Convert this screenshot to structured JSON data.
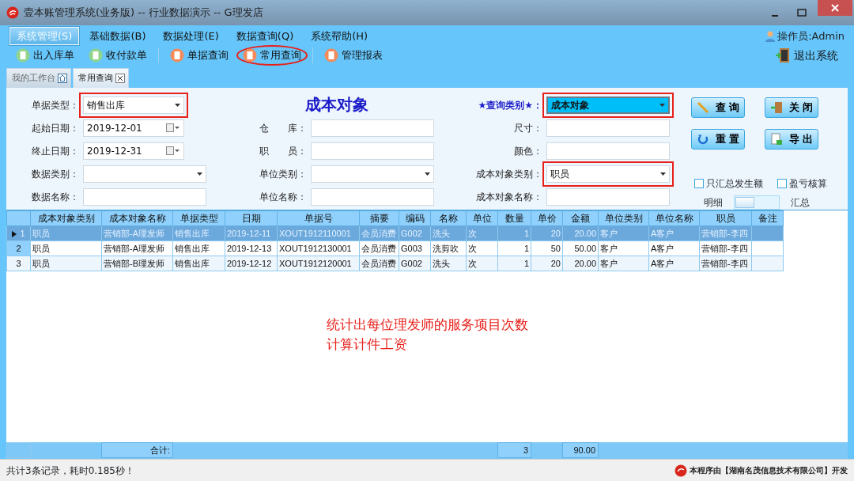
{
  "window": {
    "title": "壹本账管理系统(业务版) -- 行业数据演示 -- G理发店"
  },
  "menu": [
    {
      "label": "系统管理(S)",
      "selected": true
    },
    {
      "label": "基础数据(B)",
      "selected": false
    },
    {
      "label": "数据处理(E)",
      "selected": false
    },
    {
      "label": "数据查询(Q)",
      "selected": false
    },
    {
      "label": "系统帮助(H)",
      "selected": false
    }
  ],
  "operator": "操作员:Admin",
  "toolbar": [
    {
      "label": "出入库单",
      "circled": false
    },
    {
      "label": "收付款单",
      "circled": false
    },
    {
      "label": "单据查询",
      "circled": false
    },
    {
      "label": "常用查询",
      "circled": true
    },
    {
      "label": "管理报表",
      "circled": false
    }
  ],
  "exit_button": "退出系统",
  "tabs": [
    {
      "label": "我的工作台",
      "selected": false
    },
    {
      "label": "常用查询",
      "selected": true
    }
  ],
  "form": {
    "title": "成本对象",
    "columns": [
      {
        "fields": [
          {
            "label": "单据类型：",
            "kind": "select",
            "value": "销售出库",
            "highlighted": true
          },
          {
            "label": "起始日期：",
            "kind": "date",
            "value": "2019-12-01",
            "highlighted": false
          },
          {
            "label": "终止日期：",
            "kind": "date",
            "value": "2019-12-31",
            "highlighted": false
          },
          {
            "label": "数据类别：",
            "kind": "select",
            "highlighted": false
          },
          {
            "label": "数据名称：",
            "kind": "text",
            "highlighted": false
          }
        ]
      },
      {
        "fields": [
          {
            "label": "仓　　库：",
            "kind": "text",
            "highlighted": false
          },
          {
            "label": "职　　员：",
            "kind": "text",
            "highlighted": false
          },
          {
            "label": "单位类别：",
            "kind": "select",
            "highlighted": false
          },
          {
            "label": "单位名称：",
            "kind": "text",
            "highlighted": false
          }
        ]
      },
      {
        "fields": [
          {
            "label": "★查询类别★：",
            "kind": "primary-select",
            "value": "成本对象",
            "highlighted": true
          },
          {
            "label": "尺寸：",
            "kind": "text",
            "highlighted": false
          },
          {
            "label": "颜色：",
            "kind": "text",
            "highlighted": false
          },
          {
            "label": "成本对象类别：",
            "kind": "select",
            "value": "职员",
            "highlighted": true
          },
          {
            "label": "成本对象名称：",
            "kind": "text",
            "highlighted": false
          }
        ]
      }
    ]
  },
  "buttons": [
    {
      "label": "查 询",
      "kind": "query"
    },
    {
      "label": "关 闭",
      "kind": "close"
    },
    {
      "label": "重 置",
      "kind": "reset"
    },
    {
      "label": "导 出",
      "kind": "export"
    }
  ],
  "checkboxes": [
    {
      "label": "只汇总发生额",
      "checked": false
    },
    {
      "label": "盈亏核算",
      "checked": false
    }
  ],
  "view_switch": {
    "left_label": "明细",
    "right_label": "汇总",
    "on": false
  },
  "table": {
    "columns": [
      {
        "label": "成本对象类别",
        "kind": "text"
      },
      {
        "label": "成本对象名称",
        "kind": "text",
        "total": "合计:"
      },
      {
        "label": "单据类型",
        "kind": "text"
      },
      {
        "label": "日期",
        "kind": "text"
      },
      {
        "label": "单据号",
        "kind": "text"
      },
      {
        "label": "摘要",
        "kind": "text"
      },
      {
        "label": "编码",
        "kind": "text"
      },
      {
        "label": "名称",
        "kind": "text"
      },
      {
        "label": "单位",
        "kind": "text"
      },
      {
        "label": "数量",
        "kind": "number",
        "total": "3"
      },
      {
        "label": "单价",
        "kind": "number"
      },
      {
        "label": "金额",
        "kind": "number",
        "total": "90.00"
      },
      {
        "label": "单位类别",
        "kind": "text"
      },
      {
        "label": "单位名称",
        "kind": "text"
      },
      {
        "label": "职员",
        "kind": "text"
      },
      {
        "label": "备注",
        "kind": "text"
      }
    ],
    "rows": [
      {
        "number": "1",
        "selected": true,
        "cells": [
          "职员",
          "营销部-A理发师",
          "销售出库",
          "2019-12-11",
          "XOUT1912110001",
          "会员消费",
          "G002",
          "洗头",
          "次",
          "1",
          "20",
          "20.00",
          "客户",
          "A客户",
          "营销部-李四",
          ""
        ]
      },
      {
        "number": "2",
        "selected": false,
        "cells": [
          "职员",
          "营销部-A理发师",
          "销售出库",
          "2019-12-13",
          "XOUT1912130001",
          "会员消费",
          "G003",
          "洗剪吹",
          "次",
          "1",
          "50",
          "50.00",
          "客户",
          "A客户",
          "营销部-李四",
          ""
        ]
      },
      {
        "number": "3",
        "selected": false,
        "cells": [
          "职员",
          "营销部-B理发师",
          "销售出库",
          "2019-12-12",
          "XOUT1912120001",
          "会员消费",
          "G002",
          "洗头",
          "次",
          "1",
          "20",
          "20.00",
          "客户",
          "A客户",
          "营销部-李四",
          ""
        ]
      }
    ]
  },
  "annotation": [
    "统计出每位理发师的服务项目次数",
    "计算计件工资"
  ],
  "status": {
    "message": "共计3条记录，耗时0.185秒！",
    "credit": "本程序由【湖南名茂信息技术有限公司】开发"
  }
}
